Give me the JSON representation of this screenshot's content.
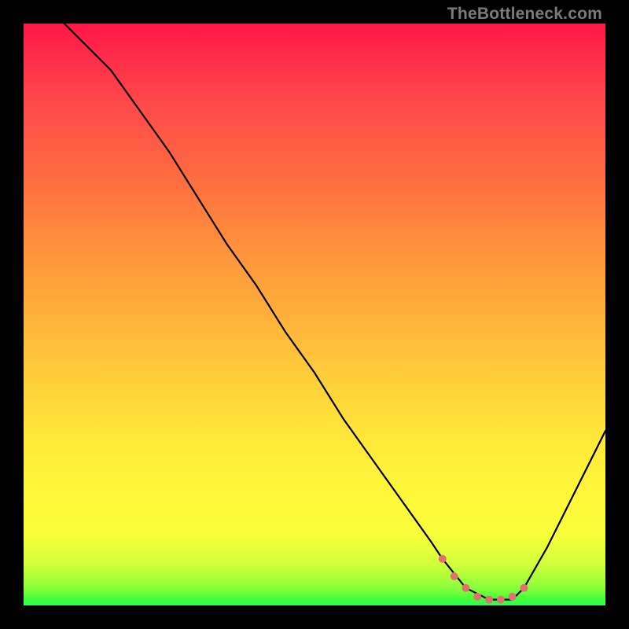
{
  "watermark": "TheBottleneck.com",
  "colors": {
    "background": "#000000",
    "curve": "#000000",
    "marker": "#e27070",
    "watermark": "#7a7a7a"
  },
  "chart_data": {
    "type": "line",
    "title": "",
    "xlabel": "",
    "ylabel": "",
    "xlim": [
      0,
      100
    ],
    "ylim": [
      0,
      100
    ],
    "grid": false,
    "legend": false,
    "series": [
      {
        "name": "bottleneck-curve",
        "x": [
          7,
          10,
          15,
          20,
          25,
          30,
          35,
          40,
          45,
          50,
          55,
          60,
          65,
          70,
          72,
          76,
          80,
          84,
          86,
          90,
          95,
          100
        ],
        "values": [
          100,
          97,
          92,
          85,
          78,
          70,
          62,
          55,
          47,
          40,
          32,
          25,
          18,
          11,
          8,
          3,
          1,
          1,
          3,
          10,
          20,
          30
        ]
      }
    ],
    "markers": {
      "name": "bottleneck-range",
      "x": [
        72,
        74,
        76,
        78,
        80,
        82,
        84,
        86
      ],
      "values": [
        8,
        5,
        3,
        1.5,
        1,
        1,
        1.5,
        3
      ]
    },
    "gradient_stops": [
      {
        "pct": 0,
        "color": "#ff1744"
      },
      {
        "pct": 14,
        "color": "#ff4a4a"
      },
      {
        "pct": 36,
        "color": "#ff8a3d"
      },
      {
        "pct": 62,
        "color": "#ffd13a"
      },
      {
        "pct": 82,
        "color": "#fff93a"
      },
      {
        "pct": 97,
        "color": "#8aff3a"
      },
      {
        "pct": 100,
        "color": "#2dff55"
      }
    ]
  }
}
